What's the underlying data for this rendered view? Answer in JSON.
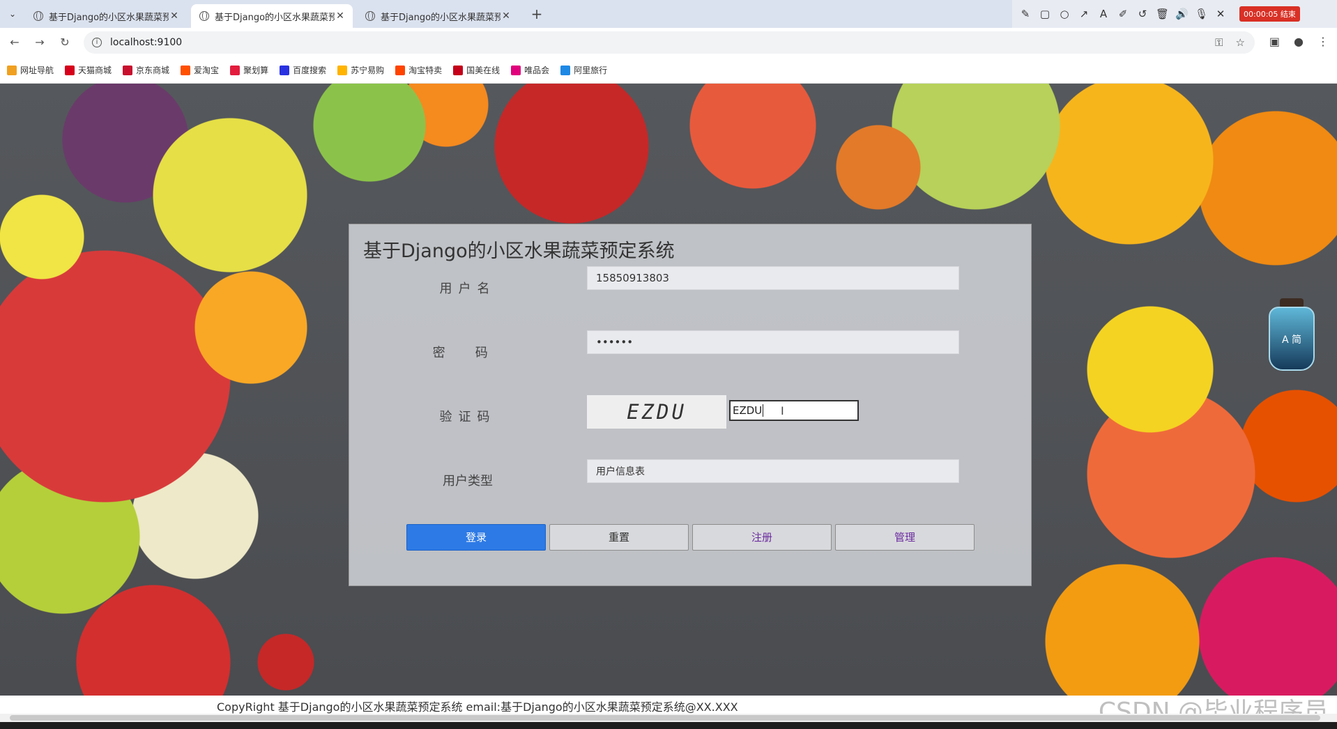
{
  "browser": {
    "tabs": [
      {
        "title": "基于Django的小区水果蔬菜预定",
        "active": false
      },
      {
        "title": "基于Django的小区水果蔬菜预定",
        "active": true
      },
      {
        "title": "基于Django的小区水果蔬菜预定",
        "active": false
      }
    ],
    "new_tab": "+",
    "recording_badge": "00:00:05 结束",
    "url": "localhost:9100",
    "bookmarks": [
      {
        "label": "网址导航",
        "color": "#f0a020"
      },
      {
        "label": "天猫商城",
        "color": "#d6001c"
      },
      {
        "label": "京东商城",
        "color": "#c8102e"
      },
      {
        "label": "爱淘宝",
        "color": "#ff5000"
      },
      {
        "label": "聚划算",
        "color": "#e31c3d"
      },
      {
        "label": "百度搜索",
        "color": "#2932e1"
      },
      {
        "label": "苏宁易购",
        "color": "#ffb400"
      },
      {
        "label": "淘宝特卖",
        "color": "#ff4400"
      },
      {
        "label": "国美在线",
        "color": "#c4001a"
      },
      {
        "label": "唯品会",
        "color": "#e0007c"
      },
      {
        "label": "阿里旅行",
        "color": "#1e88e5"
      }
    ]
  },
  "login": {
    "title": "基于Django的小区水果蔬菜预定系统",
    "username_label": "用户名",
    "username_value": "15850913803",
    "password_label": "密码",
    "password_value": "••••••",
    "captcha_label": "验证码",
    "captcha_image_text": "EZDU",
    "captcha_value": "EZDU",
    "usertype_label": "用户类型",
    "usertype_value": "用户信息表",
    "buttons": {
      "login": "登录",
      "reset": "重置",
      "register": "注册",
      "admin": "管理"
    }
  },
  "jar_label": "A 简",
  "footer": {
    "copyright": "CopyRight 基于Django的小区水果蔬菜预定系统 email:基于Django的小区水果蔬菜预定系统@XX.XXX"
  },
  "watermark": "CSDN @毕业程序员",
  "colors": {
    "primary_button": "#2d7ae6",
    "purple_text": "#6b2aa0",
    "recording_badge": "#d93025"
  }
}
